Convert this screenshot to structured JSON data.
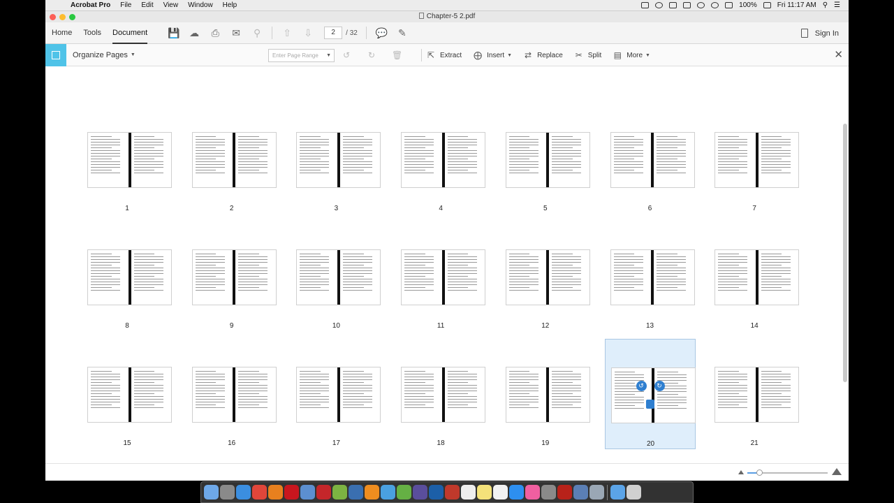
{
  "menubar": {
    "app_name": "Acrobat Pro",
    "menus": [
      "File",
      "Edit",
      "View",
      "Window",
      "Help"
    ],
    "battery": "100%",
    "clock": "Fri 11:17 AM"
  },
  "window": {
    "title": "Chapter-5 2.pdf"
  },
  "toolbar": {
    "tabs": [
      "Home",
      "Tools",
      "Document"
    ],
    "active_tab": "Document",
    "current_page": "2",
    "page_total": "/ 32",
    "sign_in": "Sign In"
  },
  "organize": {
    "title": "Organize Pages",
    "range_placeholder": "Enter Page Range",
    "extract": "Extract",
    "insert": "Insert",
    "replace": "Replace",
    "split": "Split",
    "more": "More"
  },
  "pages": [
    "1",
    "2",
    "3",
    "4",
    "5",
    "6",
    "7",
    "8",
    "9",
    "10",
    "11",
    "12",
    "13",
    "14",
    "15",
    "16",
    "17",
    "18",
    "19",
    "20",
    "21"
  ],
  "selected_page": "20",
  "zoom_level_fraction": 0.15,
  "colors": {
    "organize_accent": "#4fc3e8",
    "selection_bg": "#dfeefb",
    "hover_control": "#2f7fd0"
  },
  "dock": {
    "apps": [
      "finder",
      "launchpad",
      "safari",
      "chrome",
      "firefox",
      "opera",
      "preview",
      "filezilla",
      "transmission",
      "bittorrent",
      "vlc",
      "photos",
      "utorrent",
      "textmate",
      "photoshop",
      "photo-booth",
      "calendar",
      "notes",
      "reminders",
      "app-store",
      "itunes",
      "system-preferences",
      "acrobat",
      "preview-alt",
      "image-capture",
      "downloads",
      "trash"
    ]
  }
}
